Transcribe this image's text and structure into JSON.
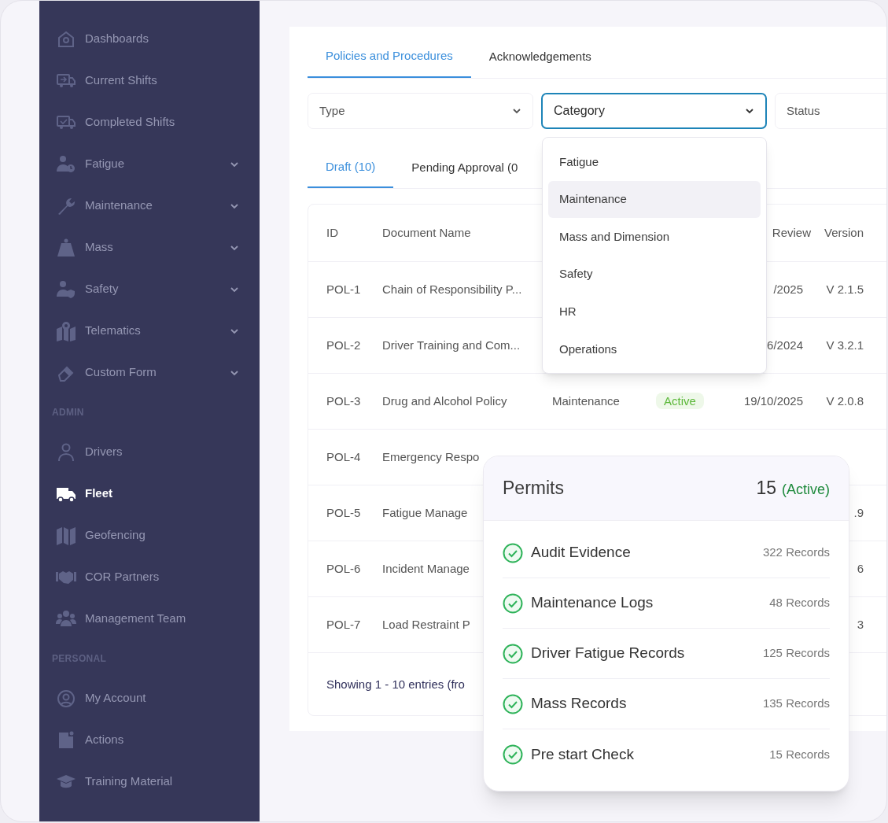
{
  "sidebar": {
    "sections": [
      {
        "items": [
          {
            "label": "Dashboards",
            "expandable": false,
            "selected": false
          },
          {
            "label": "Current Shifts",
            "expandable": false,
            "selected": false
          },
          {
            "label": "Completed Shifts",
            "expandable": false,
            "selected": false
          },
          {
            "label": "Fatigue",
            "expandable": true,
            "selected": false
          },
          {
            "label": "Maintenance",
            "expandable": true,
            "selected": false
          },
          {
            "label": "Mass",
            "expandable": true,
            "selected": false
          },
          {
            "label": "Safety",
            "expandable": true,
            "selected": false
          },
          {
            "label": "Telematics",
            "expandable": true,
            "selected": false
          },
          {
            "label": "Custom Form",
            "expandable": true,
            "selected": false
          }
        ]
      },
      {
        "heading": "ADMIN",
        "items": [
          {
            "label": "Drivers",
            "expandable": false,
            "selected": false
          },
          {
            "label": "Fleet",
            "expandable": false,
            "selected": true
          },
          {
            "label": "Geofencing",
            "expandable": false,
            "selected": false
          },
          {
            "label": "COR Partners",
            "expandable": false,
            "selected": false
          },
          {
            "label": "Management Team",
            "expandable": false,
            "selected": false
          }
        ]
      },
      {
        "heading": "PERSONAL",
        "items": [
          {
            "label": "My Account",
            "expandable": false,
            "selected": false
          },
          {
            "label": "Actions",
            "expandable": false,
            "selected": false
          },
          {
            "label": "Training Material",
            "expandable": false,
            "selected": false
          }
        ]
      }
    ]
  },
  "tabs": [
    {
      "label": "Policies and Procedures",
      "selected": true
    },
    {
      "label": "Acknowledgements",
      "selected": false
    }
  ],
  "filters": [
    {
      "placeholder": "Type",
      "focused": false,
      "chevron": true
    },
    {
      "placeholder": "Category",
      "focused": true,
      "chevron": true
    },
    {
      "placeholder": "Status",
      "focused": false,
      "chevron": false
    }
  ],
  "category_dropdown": {
    "options": [
      {
        "label": "Fatigue",
        "highlighted": false
      },
      {
        "label": "Maintenance",
        "highlighted": true
      },
      {
        "label": "Mass and Dimension",
        "highlighted": false
      },
      {
        "label": "Safety",
        "highlighted": false
      },
      {
        "label": "HR",
        "highlighted": false
      },
      {
        "label": "Operations",
        "highlighted": false
      }
    ]
  },
  "status_tabs": [
    {
      "label": "Draft (10)",
      "selected": true
    },
    {
      "label": "Pending Approval (0",
      "selected": false
    }
  ],
  "table": {
    "columns": [
      "ID",
      "Document Name",
      "",
      "",
      "Review",
      "Version"
    ],
    "rows": [
      {
        "id": "POL-1",
        "document_name": "Chain of Responsibility P...",
        "review": "/2025",
        "version": "V 2.1.5"
      },
      {
        "id": "POL-2",
        "document_name": "Driver Training and Com...",
        "review": "6/2024",
        "version": "V 3.2.1"
      },
      {
        "id": "POL-3",
        "document_name": "Drug and Alcohol Policy",
        "category": "Maintenance",
        "status": {
          "label": "Active",
          "kind": "active"
        },
        "review": "19/10/2025",
        "version": "V 2.0.8"
      },
      {
        "id": "POL-4",
        "document_name": "Emergency Respo"
      },
      {
        "id": "POL-5",
        "document_name": "Fatigue Manage",
        "version": ".9"
      },
      {
        "id": "POL-6",
        "document_name": "Incident Manage",
        "version": "6"
      },
      {
        "id": "POL-7",
        "document_name": "Load Restraint P",
        "version": "3"
      }
    ],
    "footer": "Showing 1 - 10 entries (fro"
  },
  "permits_card": {
    "title": "Permits",
    "count": "15",
    "count_status": "(Active)",
    "items": [
      {
        "label": "Audit Evidence",
        "records": "322 Records",
        "done": true
      },
      {
        "label": "Maintenance Logs",
        "records": "48 Records",
        "done": true
      },
      {
        "label": "Driver Fatigue Records",
        "records": "125 Records",
        "done": true
      },
      {
        "label": "Mass Records",
        "records": "135 Records",
        "done": true
      },
      {
        "label": "Pre start Check",
        "records": "15 Records",
        "done": true
      }
    ]
  }
}
